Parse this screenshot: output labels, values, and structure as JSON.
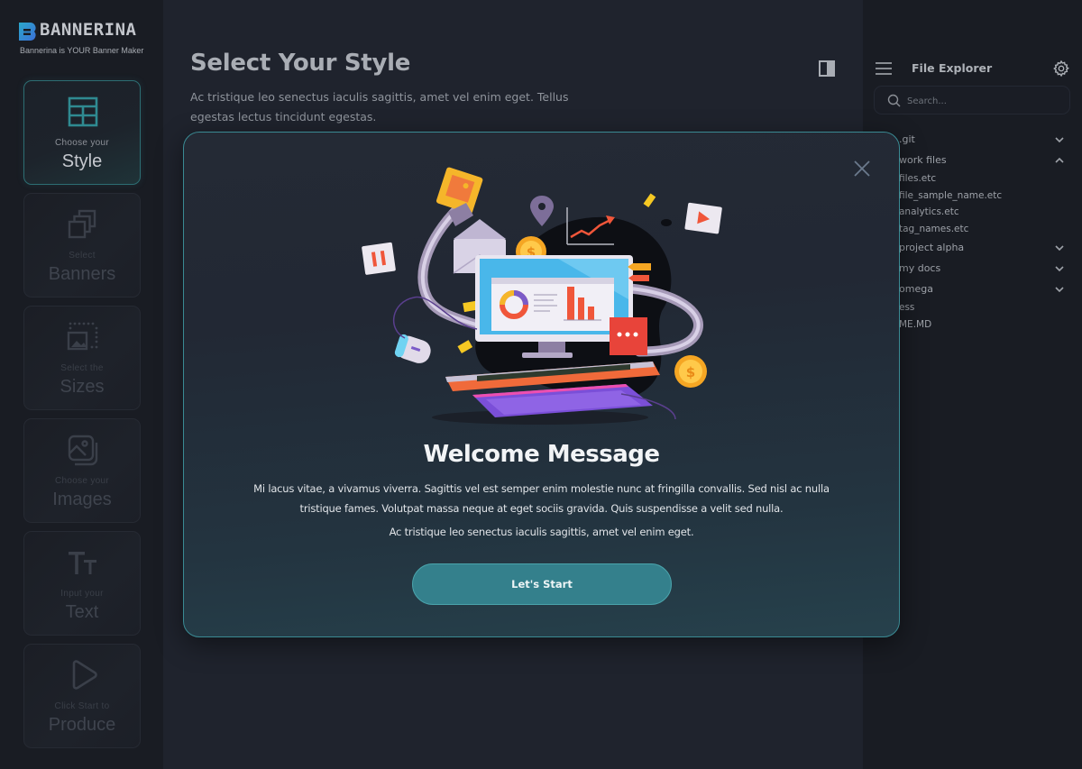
{
  "brand": {
    "name": "BANNERINA",
    "tagline": "Bannerina is YOUR Banner Maker",
    "colors": {
      "accent": "#34808c",
      "accent_border": "#3a8a93",
      "logo_gradient_start": "#2aa7c9",
      "logo_gradient_end": "#3b6fd8"
    }
  },
  "sidebar": {
    "steps": [
      {
        "icon": "table-layout-icon",
        "sub": "Choose your",
        "label": "Style",
        "active": true
      },
      {
        "icon": "stacked-squares-icon",
        "sub": "Select",
        "label": "Banners",
        "active": false
      },
      {
        "icon": "resize-image-icon",
        "sub": "Select the",
        "label": "Sizes",
        "active": false
      },
      {
        "icon": "images-icon",
        "sub": "Choose your",
        "label": "Images",
        "active": false
      },
      {
        "icon": "text-size-icon",
        "sub": "Input your",
        "label": "Text",
        "active": false
      },
      {
        "icon": "play-icon",
        "sub": "Click Start to",
        "label": "Produce",
        "active": false
      }
    ]
  },
  "main": {
    "title": "Select Your Style",
    "description": "Ac tristique leo senectus iaculis sagittis, amet vel enim eget. Tellus egestas lectus tincidunt egestas.",
    "panel_toggle_icon": "sidebar-toggle-icon"
  },
  "file_explorer": {
    "title": "File Explorer",
    "search_placeholder": "Search...",
    "search_value": "",
    "items": [
      {
        "label": ".git",
        "type": "folder",
        "expanded": false
      },
      {
        "label": "work files",
        "type": "folder",
        "expanded": true
      },
      {
        "label": "files.etc",
        "type": "file"
      },
      {
        "label": "file_sample_name.etc",
        "type": "file"
      },
      {
        "label": "analytics.etc",
        "type": "file"
      },
      {
        "label": "tag_names.etc",
        "type": "file"
      },
      {
        "label": "project alpha",
        "type": "folder",
        "expanded": false
      },
      {
        "label": "my docs",
        "type": "folder",
        "expanded": false
      },
      {
        "label": "omega",
        "type": "folder",
        "expanded": false
      },
      {
        "label": "ess",
        "type": "file"
      },
      {
        "label": "ME.MD",
        "type": "file"
      }
    ]
  },
  "modal": {
    "title": "Welcome Message",
    "body": "Mi lacus vitae, a vivamus viverra. Sagittis vel est semper enim molestie nunc at fringilla convallis. Sed nisl ac nulla tristique fames. Volutpat massa neque at eget sociis gravida. Quis suspendisse a velit sed nulla.",
    "body2": "Ac tristique leo senectus iaculis sagittis, amet vel enim eget.",
    "button_label": "Let's Start",
    "illustration": "computer-marketing-illustration"
  }
}
